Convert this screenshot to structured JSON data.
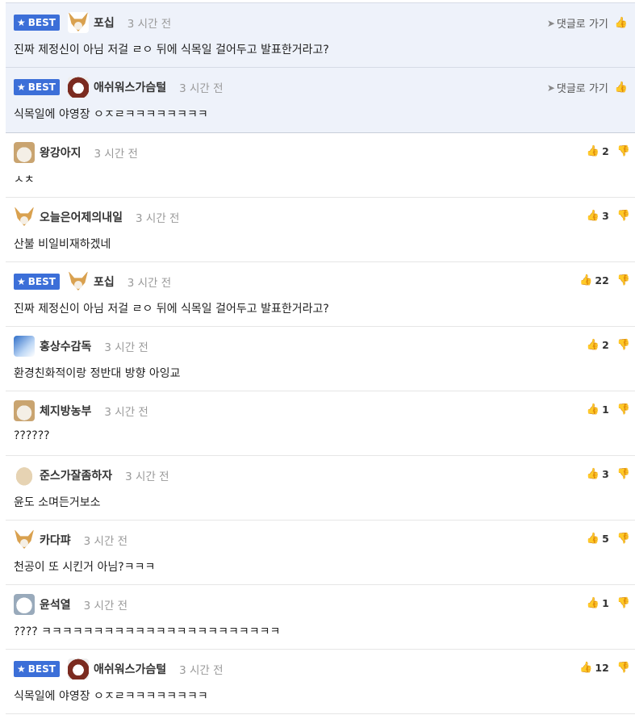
{
  "labels": {
    "best": "BEST",
    "reply": "댓글로 가기"
  },
  "icons": {
    "star": "★",
    "reply_arrow": "➤",
    "like": "👍",
    "dislike": "👎"
  },
  "pinned": [
    {
      "avatar": "av-fox",
      "nick": "포십",
      "time": "3 시간 전",
      "text": "진짜 제정신이 아님 저걸 ㄹㅇ 뒤에 식목일 걸어두고 발표한거라고?"
    },
    {
      "avatar": "av-bear",
      "nick": "애쉬워스가슴털",
      "time": "3 시간 전",
      "text": "식목일에 야영장 ㅇㅈㄹㅋㅋㅋㅋㅋㅋㅋㅋ"
    }
  ],
  "comments": [
    {
      "avatar": "av-dog",
      "best": false,
      "nick": "왕강아지",
      "time": "3 시간 전",
      "text": "ㅅㅊ",
      "likes": "2"
    },
    {
      "avatar": "av-fox",
      "best": false,
      "nick": "오늘은어제의내일",
      "time": "3 시간 전",
      "text": "산불 비일비재하겠네",
      "likes": "3"
    },
    {
      "avatar": "av-fox",
      "best": true,
      "nick": "포십",
      "time": "3 시간 전",
      "text": "진짜 제정신이 아님 저걸 ㄹㅇ 뒤에 식목일 걸어두고 발표한거라고?",
      "likes": "22"
    },
    {
      "avatar": "av-blue",
      "best": false,
      "nick": "홍상수감독",
      "time": "3 시간 전",
      "text": "환경친화적이랑 정반대 방향 아잉교",
      "likes": "2"
    },
    {
      "avatar": "av-dog",
      "best": false,
      "nick": "체지방농부",
      "time": "3 시간 전",
      "text": "??????",
      "likes": "1"
    },
    {
      "avatar": "av-tan",
      "best": false,
      "nick": "준스가잘좀하자",
      "time": "3 시간 전",
      "text": "윤도 소며든거보소",
      "likes": "3"
    },
    {
      "avatar": "av-fox",
      "best": false,
      "nick": "카다퍄",
      "time": "3 시간 전",
      "text": "천공이 또 시킨거 아님?ㅋㅋㅋ",
      "likes": "5"
    },
    {
      "avatar": "av-white",
      "best": false,
      "nick": "윤석열",
      "time": "3 시간 전",
      "text": "???? ㅋㅋㅋㅋㅋㅋㅋㅋㅋㅋㅋㅋㅋㅋㅋㅋㅋㅋㅋㅋㅋㅋㅋ",
      "likes": "1"
    },
    {
      "avatar": "av-bear",
      "best": true,
      "nick": "애쉬워스가슴털",
      "time": "3 시간 전",
      "text": "식목일에 야영장 ㅇㅈㄹㅋㅋㅋㅋㅋㅋㅋㅋ",
      "likes": "12"
    }
  ]
}
